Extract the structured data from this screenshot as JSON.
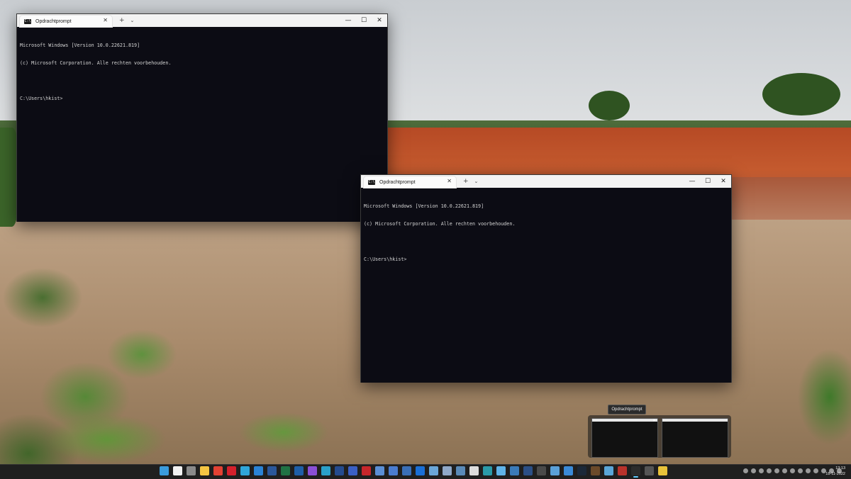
{
  "windows": [
    {
      "tab_title": "Opdrachtprompt",
      "tab_icon_text": "C:\\",
      "new_tab": "+",
      "dropdown": "⌄",
      "controls": {
        "minimize": "—",
        "maximize": "☐",
        "close": "✕"
      },
      "lines": [
        "Microsoft Windows [Version 10.0.22621.819]",
        "(c) Microsoft Corporation. Alle rechten voorbehouden.",
        "",
        "C:\\Users\\hkist>"
      ]
    },
    {
      "tab_title": "Opdrachtprompt",
      "tab_icon_text": "C:\\",
      "new_tab": "+",
      "dropdown": "⌄",
      "controls": {
        "minimize": "—",
        "maximize": "☐",
        "close": "✕"
      },
      "lines": [
        "Microsoft Windows [Version 10.0.22621.819]",
        "(c) Microsoft Corporation. Alle rechten voorbehouden.",
        "",
        "C:\\Users\\hkist>"
      ]
    }
  ],
  "taskbar_preview": {
    "tooltip": "Opdrachtprompt",
    "close": "✕"
  },
  "taskbar": {
    "icons": [
      {
        "name": "start-windows-icon",
        "color": "#3a9bdc"
      },
      {
        "name": "calendar-icon",
        "color": "#f2f2f2"
      },
      {
        "name": "settings-gear-icon",
        "color": "#8a8a8a"
      },
      {
        "name": "file-explorer-icon",
        "color": "#f4c542"
      },
      {
        "name": "chrome-icon",
        "color": "#e34133"
      },
      {
        "name": "opera-icon",
        "color": "#d4202c"
      },
      {
        "name": "edge-icon",
        "color": "#2fa6d9"
      },
      {
        "name": "store-icon",
        "color": "#2a83d6"
      },
      {
        "name": "word-icon",
        "color": "#2b579a"
      },
      {
        "name": "excel-icon",
        "color": "#1f7244"
      },
      {
        "name": "app-blue-icon",
        "color": "#1e5fa8"
      },
      {
        "name": "app-purple-icon",
        "color": "#8a4fd6"
      },
      {
        "name": "app-cyan-icon",
        "color": "#2aa0c9"
      },
      {
        "name": "app-darkblue-icon",
        "color": "#244b8f"
      },
      {
        "name": "app-navy-icon",
        "color": "#3a5fc4"
      },
      {
        "name": "filezilla-icon",
        "color": "#c7262b"
      },
      {
        "name": "app-monitor-icon",
        "color": "#5a8fd6"
      },
      {
        "name": "save-disk-icon",
        "color": "#4a7cd0"
      },
      {
        "name": "app-globe-icon",
        "color": "#3a6fb8"
      },
      {
        "name": "onepassword-icon",
        "color": "#1a6fd6"
      },
      {
        "name": "app-phone-icon",
        "color": "#6aa6d8"
      },
      {
        "name": "app-doc-icon",
        "color": "#8fa8c8"
      },
      {
        "name": "app-image-icon",
        "color": "#5a8ab8"
      },
      {
        "name": "media-player-icon",
        "color": "#dddddd"
      },
      {
        "name": "app-teal-icon",
        "color": "#2a9aa8"
      },
      {
        "name": "notepad-icon",
        "color": "#5fb3e8"
      },
      {
        "name": "app-list-icon",
        "color": "#3a7ab8"
      },
      {
        "name": "powershell-icon",
        "color": "#2b4f86"
      },
      {
        "name": "app-window-icon",
        "color": "#4a4a4a"
      },
      {
        "name": "app-camera-icon",
        "color": "#5aa0d8"
      },
      {
        "name": "app-settings-icon",
        "color": "#3a8ad8"
      },
      {
        "name": "steam-icon",
        "color": "#1b2838"
      },
      {
        "name": "app-brown-icon",
        "color": "#6b4a2a"
      },
      {
        "name": "app-bag-icon",
        "color": "#5aa6d8"
      },
      {
        "name": "filezilla-red-icon",
        "color": "#b8322b"
      },
      {
        "name": "terminal-icon",
        "color": "#2c2c2c"
      },
      {
        "name": "app-gray-icon",
        "color": "#555555"
      },
      {
        "name": "file-manager-yellow-icon",
        "color": "#e8c23a"
      }
    ],
    "active_index": 35,
    "tray_icons": [
      "tray-icon-1",
      "tray-icon-2",
      "tray-icon-3",
      "tray-icon-4",
      "tray-icon-5",
      "tray-icon-6",
      "tray-icon-7",
      "tray-icon-8",
      "tray-icon-9",
      "tray-icon-10",
      "tray-icon-11",
      "tray-icon-12",
      "tray-icon-13"
    ],
    "time": "13:13",
    "date": "18-11-2022"
  }
}
